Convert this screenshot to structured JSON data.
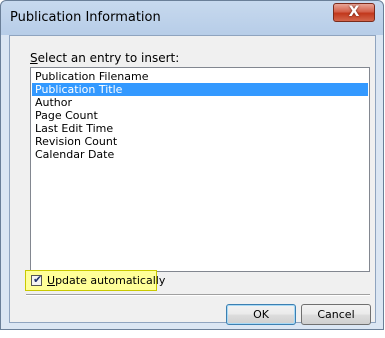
{
  "window": {
    "title": "Publication Information",
    "close_icon": "close-x-icon",
    "close_glyph": "X"
  },
  "prompt": {
    "mnemonic": "S",
    "rest": "elect an entry to insert:"
  },
  "list": {
    "items": [
      {
        "label": "Publication Filename",
        "selected": false
      },
      {
        "label": "Publication Title",
        "selected": true
      },
      {
        "label": "Author",
        "selected": false
      },
      {
        "label": "Page Count",
        "selected": false
      },
      {
        "label": "Last Edit Time",
        "selected": false
      },
      {
        "label": "Revision Count",
        "selected": false
      },
      {
        "label": "Calendar Date",
        "selected": false
      }
    ]
  },
  "update_checkbox": {
    "checked": true,
    "mnemonic": "U",
    "rest": "pdate automatically",
    "highlight_color": "#ffff99"
  },
  "buttons": {
    "ok": "OK",
    "cancel": "Cancel"
  },
  "colors": {
    "selection": "#3399ff",
    "close_button": "#c2381c"
  }
}
